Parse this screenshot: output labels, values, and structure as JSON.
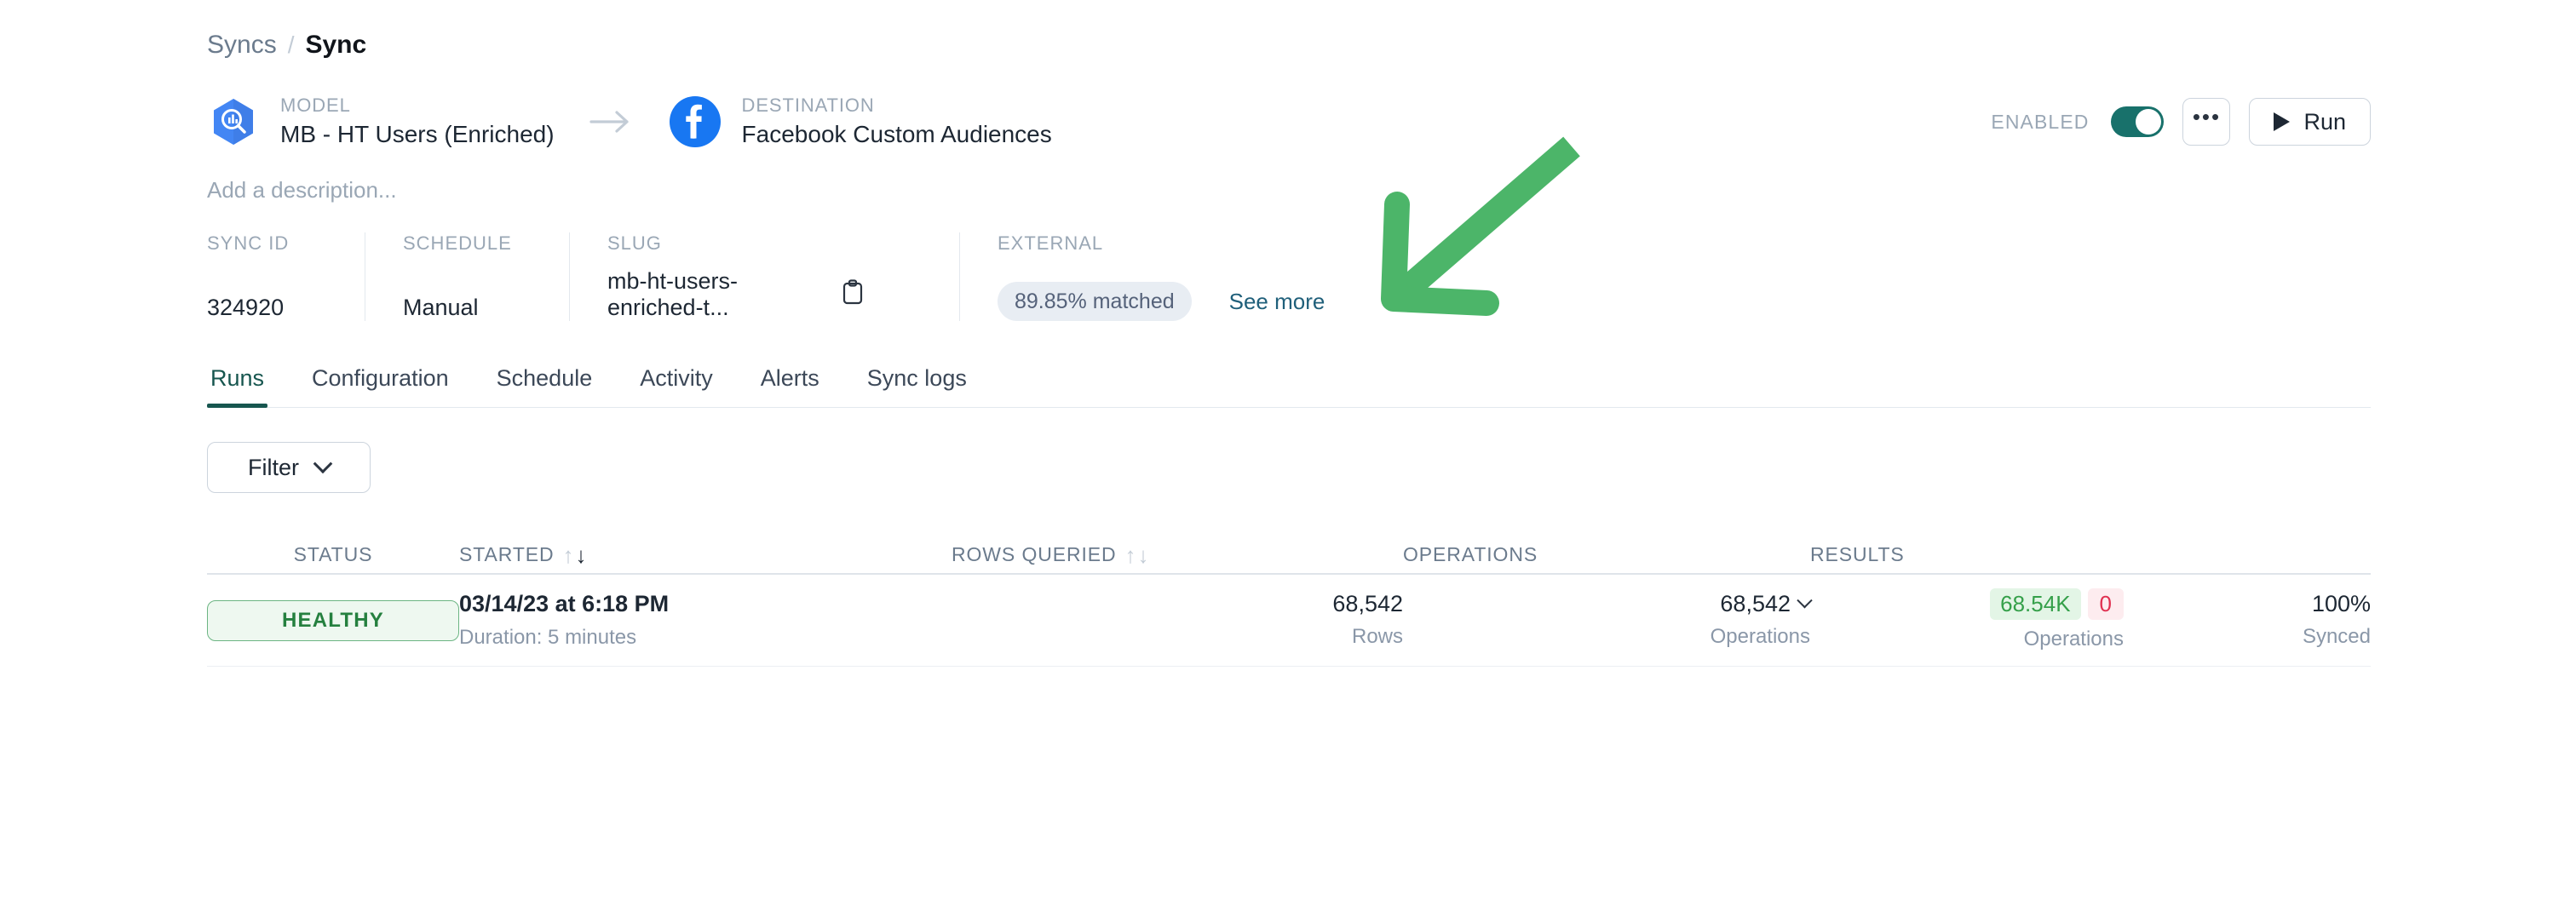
{
  "breadcrumb": {
    "parent": "Syncs",
    "separator": "/",
    "current": "Sync"
  },
  "header": {
    "model": {
      "kicker": "MODEL",
      "name": "MB - HT Users (Enriched)",
      "icon": "bigquery-icon"
    },
    "flow_arrow": "arrow-right-icon",
    "destination": {
      "kicker": "DESTINATION",
      "name": "Facebook Custom Audiences",
      "icon": "facebook-icon"
    },
    "enabled_label": "ENABLED",
    "enabled_state": "on",
    "more_label": "•••",
    "run_label": "Run"
  },
  "description_placeholder": "Add a description...",
  "meta": {
    "sync_id": {
      "label": "SYNC ID",
      "value": "324920"
    },
    "schedule": {
      "label": "SCHEDULE",
      "value": "Manual"
    },
    "slug": {
      "label": "SLUG",
      "value": "mb-ht-users-enriched-t...",
      "copy_icon": "clipboard-icon"
    },
    "external": {
      "label": "EXTERNAL",
      "match_pill": "89.85% matched",
      "see_more": "See more"
    }
  },
  "tabs": [
    {
      "label": "Runs",
      "active": true
    },
    {
      "label": "Configuration",
      "active": false
    },
    {
      "label": "Schedule",
      "active": false
    },
    {
      "label": "Activity",
      "active": false
    },
    {
      "label": "Alerts",
      "active": false
    },
    {
      "label": "Sync logs",
      "active": false
    }
  ],
  "filter": {
    "label": "Filter",
    "icon": "chevron-down-icon"
  },
  "table": {
    "columns": [
      {
        "label": "STATUS",
        "sortable": false
      },
      {
        "label": "STARTED",
        "sortable": true,
        "sort": "desc"
      },
      {
        "label": "ROWS QUERIED",
        "sortable": true,
        "sort": "none"
      },
      {
        "label": "OPERATIONS",
        "sortable": false
      },
      {
        "label": "RESULTS",
        "sortable": false
      }
    ],
    "rows": [
      {
        "status": "HEALTHY",
        "started": "03/14/23 at 6:18 PM",
        "duration": "Duration: 5 minutes",
        "rows_queried_value": "68,542",
        "rows_queried_unit": "Rows",
        "operations_value": "68,542",
        "operations_unit": "Operations",
        "operations_expander": "chevron-down-icon",
        "results_success": "68.54K",
        "results_failed": "0",
        "results_unit": "Operations",
        "synced_value": "100%",
        "synced_unit": "Synced"
      }
    ]
  },
  "annotation": {
    "type": "arrow",
    "color": "#4cb569",
    "points_to": "external-match-pill"
  },
  "colors": {
    "accent_teal": "#17564f",
    "toggle_on": "#18716b",
    "link": "#1f5f7a",
    "healthy_text": "#25803f",
    "healthy_bg": "#eef8f0",
    "success_pill": "#35a04a",
    "error_pill": "#e03050",
    "annotation_green": "#4cb569"
  }
}
